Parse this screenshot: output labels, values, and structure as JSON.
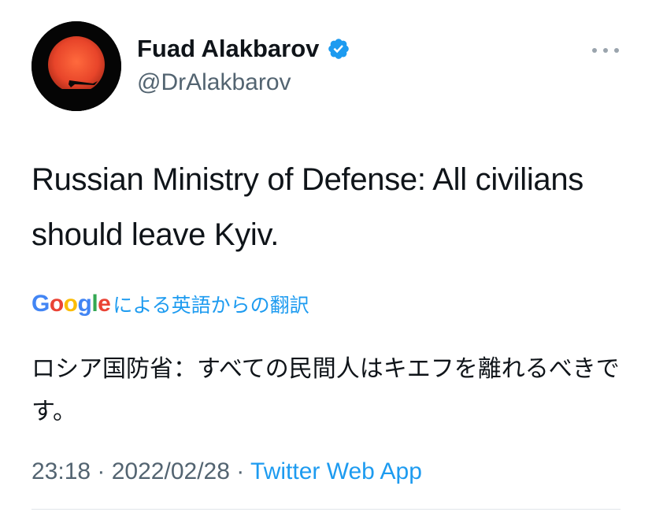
{
  "author": {
    "display_name": "Fuad Alakbarov",
    "handle": "@DrAlakbarov",
    "verified": true,
    "avatar_icon": "sunset-airplane-avatar"
  },
  "more_icon": "more-dots-icon",
  "tweet": {
    "text": "Russian Ministry of Defense: All civilians should leave Kyiv."
  },
  "translation": {
    "google_logo": [
      "G",
      "o",
      "o",
      "g",
      "l",
      "e"
    ],
    "label": "による英語からの翻訳",
    "text": "ロシア国防省：すべての民間人はキエフを離れるべきです。"
  },
  "meta": {
    "time": "23:18",
    "separator": " · ",
    "date": "2022/02/28",
    "source": "Twitter Web App"
  },
  "colors": {
    "accent": "#1d9bf0",
    "secondary_text": "#536471",
    "primary_text": "#0f1419",
    "avatar_sun": "#e8452a"
  }
}
